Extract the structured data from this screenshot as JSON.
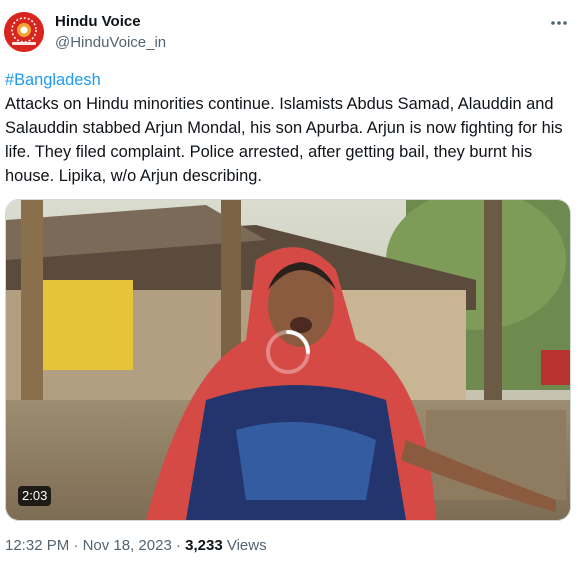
{
  "author": {
    "name": "Hindu Voice",
    "handle": "@HinduVoice_in"
  },
  "tweet": {
    "hashtag": "#Bangladesh",
    "body": "Attacks on Hindu minorities continue. Islamists Abdus Samad, Alauddin and Salauddin stabbed Arjun Mondal, his son Apurba. Arjun is now fighting for his life. They filed complaint. Police arrested, after getting bail, they burnt his house. Lipika, w/o Arjun describing."
  },
  "media": {
    "duration": "2:03"
  },
  "meta": {
    "time": "12:32 PM",
    "date": "Nov 18, 2023",
    "views_count": "3,233",
    "views_label": "Views",
    "separator": "·"
  },
  "colors": {
    "link": "#1d9bf0",
    "secondary": "#536471",
    "avatar_bg": "#d8261f"
  },
  "icons": {
    "more": "more-horizontal-icon",
    "loading": "loading-spinner-icon"
  }
}
